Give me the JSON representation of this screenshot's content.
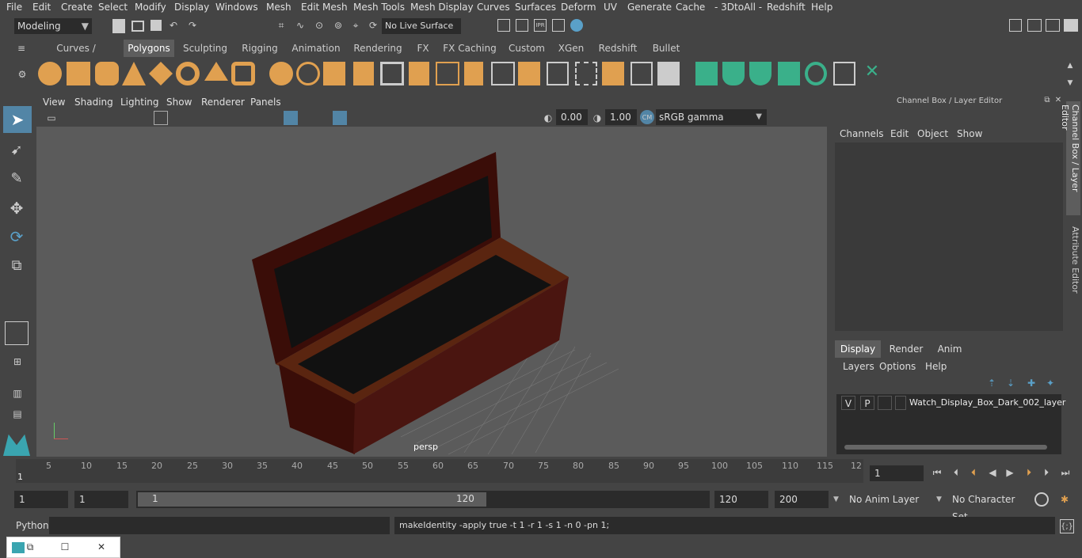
{
  "menubar": [
    "File",
    "Edit",
    "Create",
    "Select",
    "Modify",
    "Display",
    "Windows",
    "Mesh",
    "Edit Mesh",
    "Mesh Tools",
    "Mesh Display",
    "Curves",
    "Surfaces",
    "Deform",
    "UV",
    "Generate",
    "Cache",
    "- 3DtoAll -",
    "Redshift",
    "Help"
  ],
  "statusline": {
    "workspace": "Modeling",
    "live_surface": "No Live Surface"
  },
  "shelf_tabs": [
    "Curves / Surfaces",
    "Polygons",
    "Sculpting",
    "Rigging",
    "Animation",
    "Rendering",
    "FX",
    "FX Caching",
    "Custom",
    "XGen",
    "Redshift",
    "Bullet"
  ],
  "shelf_active": "Polygons",
  "panel_menu": [
    "View",
    "Shading",
    "Lighting",
    "Show",
    "Renderer",
    "Panels"
  ],
  "panel_tools": {
    "exposure": "0.00",
    "gamma": "1.00",
    "colorspace": "sRGB gamma"
  },
  "viewport": {
    "camera_label": "persp"
  },
  "channel_box": {
    "title": "Channel Box / Layer Editor",
    "menu": [
      "Channels",
      "Edit",
      "Object",
      "Show"
    ],
    "tabs": [
      "Display",
      "Render",
      "Anim"
    ],
    "active_tab": "Display",
    "layer_menu": [
      "Layers",
      "Options",
      "Help"
    ],
    "layer": {
      "v": "V",
      "p": "P",
      "name": "Watch_Display_Box_Dark_002_layer"
    }
  },
  "side_tabs": [
    "Channel Box / Layer Editor",
    "Attribute Editor"
  ],
  "timeline": {
    "ticks": [
      "5",
      "10",
      "15",
      "20",
      "25",
      "30",
      "35",
      "40",
      "45",
      "50",
      "55",
      "60",
      "65",
      "70",
      "75",
      "80",
      "85",
      "90",
      "95",
      "100",
      "105",
      "110",
      "115",
      "12"
    ],
    "start_label": "1",
    "current_frame": "1"
  },
  "range": {
    "start": "1",
    "start2": "1",
    "slider_start": "1",
    "slider_end": "120",
    "end": "120",
    "end2": "200",
    "anim_layer": "No Anim Layer",
    "char_set": "No Character Set"
  },
  "cmdline": {
    "lang": "Python",
    "result": "makeIdentity -apply true -t 1 -r 1 -s 1 -n 0 -pn 1;"
  },
  "colors": {
    "accent": "#5285a6",
    "shelf_orange": "#e0a050",
    "shelf_green": "#3ab08a"
  }
}
